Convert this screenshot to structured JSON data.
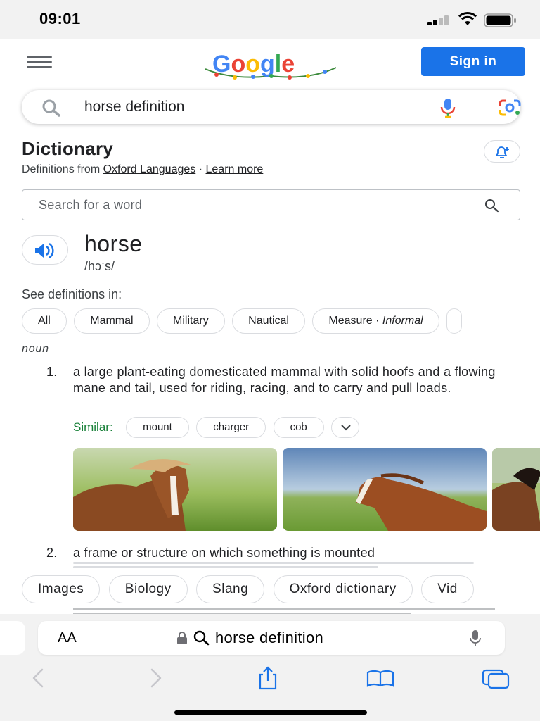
{
  "status_bar": {
    "time": "09:01"
  },
  "header": {
    "sign_in_label": "Sign in"
  },
  "search": {
    "query": "horse definition"
  },
  "dictionary": {
    "title": "Dictionary",
    "definitions_from": "Definitions from",
    "source_link": "Oxford Languages",
    "separator": "·",
    "learn_more": "Learn more",
    "word_search_placeholder": "Search for a word",
    "word": "horse",
    "phonetic": "/hɔːs/",
    "see_definitions_in": "See definitions in:",
    "categories": [
      "All",
      "Mammal",
      "Military",
      "Nautical"
    ],
    "category_measure": "Measure · ",
    "category_informal": "Informal",
    "part_of_speech": "noun",
    "definitions": [
      {
        "number": "1.",
        "text_1": "a large plant-eating ",
        "link_1": "domesticated",
        "text_2": " ",
        "link_2": "mammal",
        "text_3": " with solid ",
        "link_3": "hoofs",
        "text_4": " and a flowing mane and tail, used for riding, racing, and to carry and pull loads."
      },
      {
        "number": "2.",
        "text": "a frame or structure on which something is mounted"
      }
    ],
    "similar_label": "Similar:",
    "similar_words": [
      "mount",
      "charger",
      "cob"
    ]
  },
  "related_searches": [
    "Images",
    "Biology",
    "Slang",
    "Oxford dictionary",
    "Vid"
  ],
  "safari": {
    "text_size_label": "AA",
    "address_text": "horse definition"
  },
  "icons": {
    "menu": "hamburger-menu-icon",
    "search": "search-icon",
    "mic": "microphone-icon",
    "lens": "google-lens-icon",
    "alert": "add-alert-icon",
    "speaker": "speaker-icon",
    "chevron": "chevron-down-icon",
    "back": "back-arrow-icon",
    "forward": "forward-arrow-icon",
    "share": "share-icon",
    "bookmarks": "bookmarks-icon",
    "tabs": "tabs-icon"
  },
  "colors": {
    "accent_blue": "#1a73e8",
    "similar_green": "#188038"
  }
}
